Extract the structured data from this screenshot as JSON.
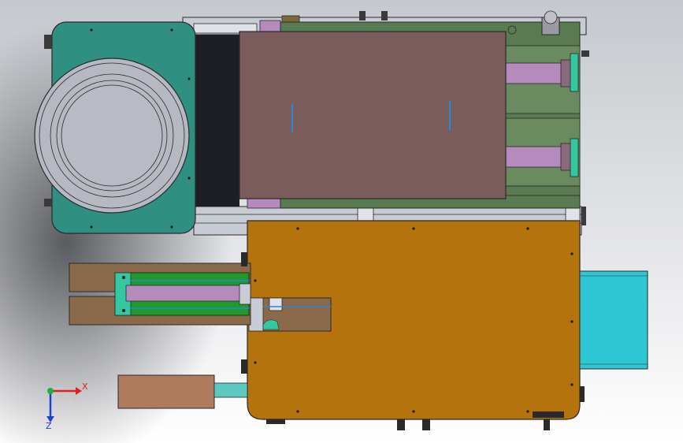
{
  "viewport": {
    "background_top": "#c9ccd1",
    "background_mid": "#e6e7ea",
    "background_bottom": "#ffffff",
    "view": "top (XZ plane)"
  },
  "colors": {
    "teal_plate": "#2f8f80",
    "disc": "#b6b9c2",
    "brown_plate": "#7a5c5c",
    "green_frame": "#5a7a52",
    "purple_cylinder": "#b58bbd",
    "mint_bracket": "#33c8a0",
    "orange_plate": "#b5730d",
    "cyan_block": "#2fc7d4",
    "wood_block": "#8a6a4a",
    "tan_block": "#b07b5d",
    "bright_green": "#1f9a2b",
    "blue_rod": "#2a88d4",
    "rail_grey": "#c8ccd4",
    "dark_line": "#2a2a2a",
    "screw": "#1a1a1a"
  },
  "axis_triad": {
    "x_label": "X",
    "z_label": "Z",
    "x_color": "#e02020",
    "z_color": "#2040d0",
    "y_color": "#20b040"
  }
}
